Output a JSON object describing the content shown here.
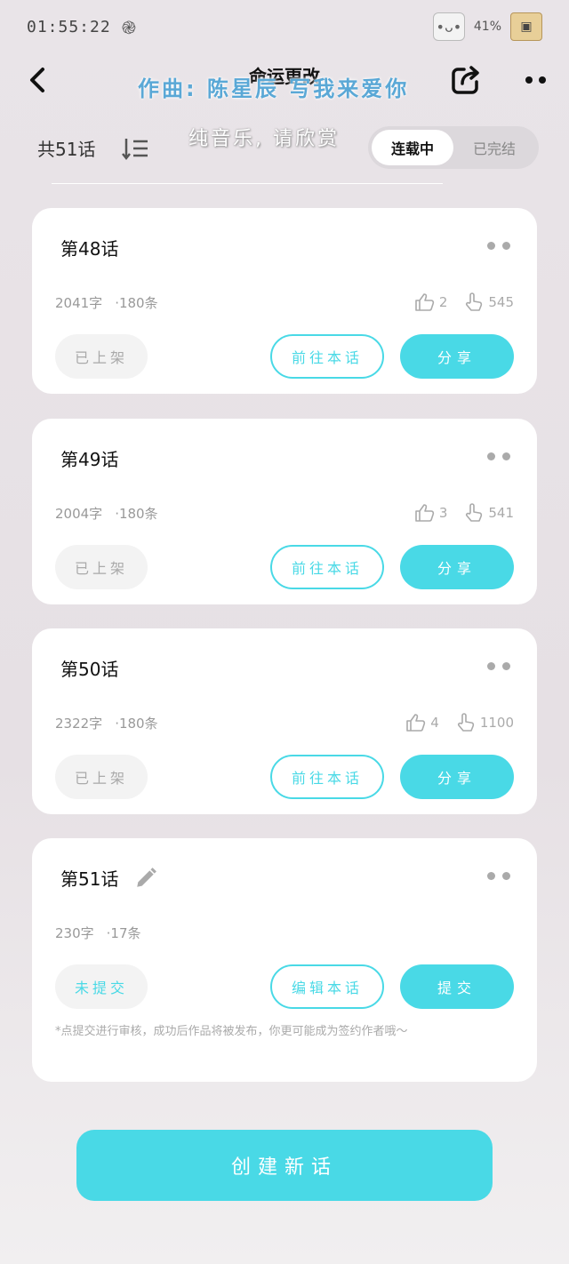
{
  "status_bar": {
    "time": "01:55:22",
    "battery": "41%"
  },
  "nav": {
    "title": "命运更改",
    "song_overlay": "作曲: 陈星辰 写我来爱你",
    "sub_overlay": "纯音乐, 请欣赏"
  },
  "toolbar": {
    "total": "共51话",
    "toggle_active": "连载中",
    "toggle_inactive": "已完结"
  },
  "chapters": [
    {
      "title": "第48话",
      "words": "2041字",
      "comments": "·180条",
      "likes": "2",
      "views": "545",
      "status": "已上架",
      "secondary": "前往本话",
      "primary": "分享"
    },
    {
      "title": "第49话",
      "words": "2004字",
      "comments": "·180条",
      "likes": "3",
      "views": "541",
      "status": "已上架",
      "secondary": "前往本话",
      "primary": "分享"
    },
    {
      "title": "第50话",
      "words": "2322字",
      "comments": "·180条",
      "likes": "4",
      "views": "1100",
      "status": "已上架",
      "secondary": "前往本话",
      "primary": "分享"
    },
    {
      "title": "第51话",
      "words": "230字",
      "comments": "·17条",
      "status": "未提交",
      "secondary": "编辑本话",
      "primary": "提交",
      "note": "*点提交进行审核，成功后作品将被发布，你更可能成为签约作者哦～"
    }
  ],
  "create_button": "创建新话",
  "colors": {
    "accent": "#49d9e6",
    "background": "#e9e4e8"
  }
}
